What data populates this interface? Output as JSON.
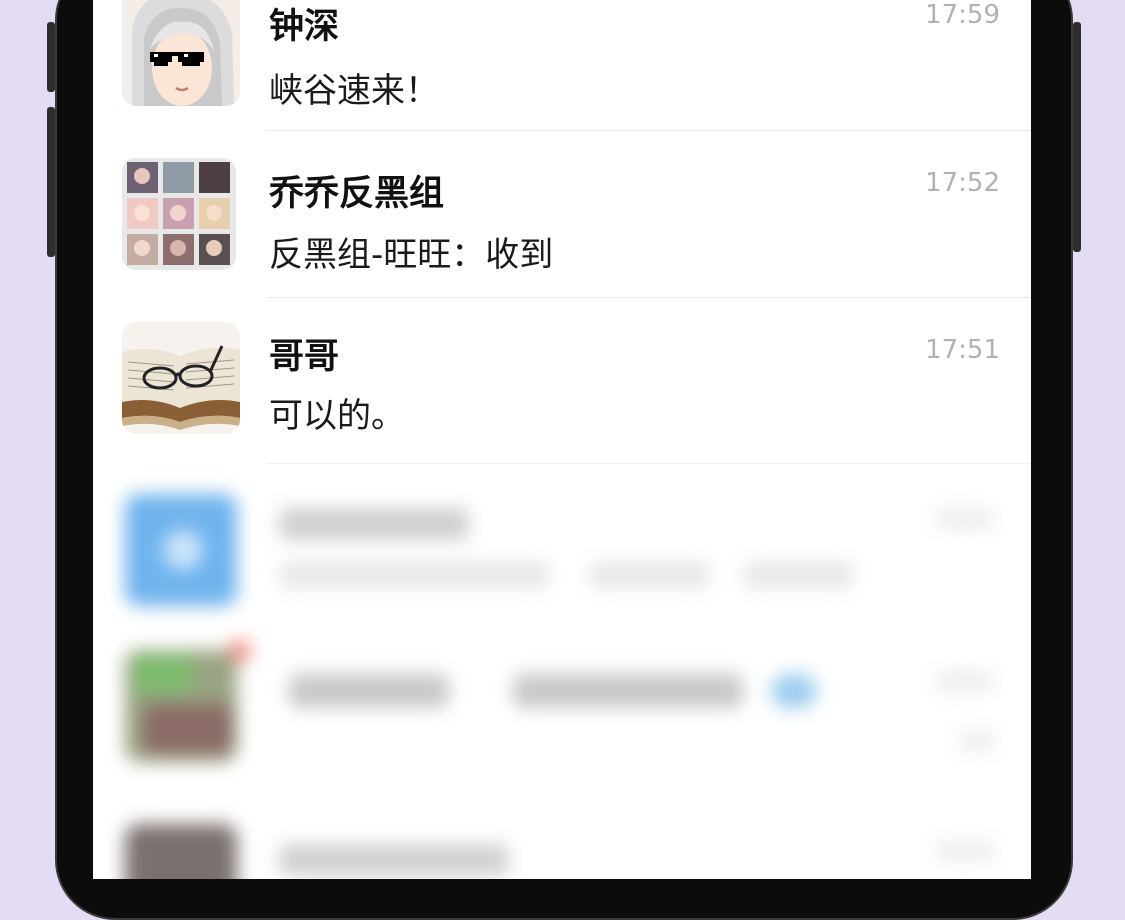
{
  "chats": [
    {
      "name": "钟深",
      "preview": "峡谷速来！",
      "time": "17:59",
      "avatar_icon": "anime-girl-sunglasses-avatar"
    },
    {
      "name": "乔乔反黑组",
      "preview": "反黑组-旺旺：收到",
      "time": "17:52",
      "avatar_icon": "group-photo-grid-avatar"
    },
    {
      "name": "哥哥",
      "preview": "可以的。",
      "time": "17:51",
      "avatar_icon": "book-and-glasses-avatar"
    }
  ],
  "colors": {
    "background": "#e3dcf3",
    "screen": "#ffffff",
    "name_text": "#111111",
    "time_text": "#b2b2b2",
    "divider": "#e6e6e6",
    "blurred_avatar_blue": "#6fb3ee"
  }
}
